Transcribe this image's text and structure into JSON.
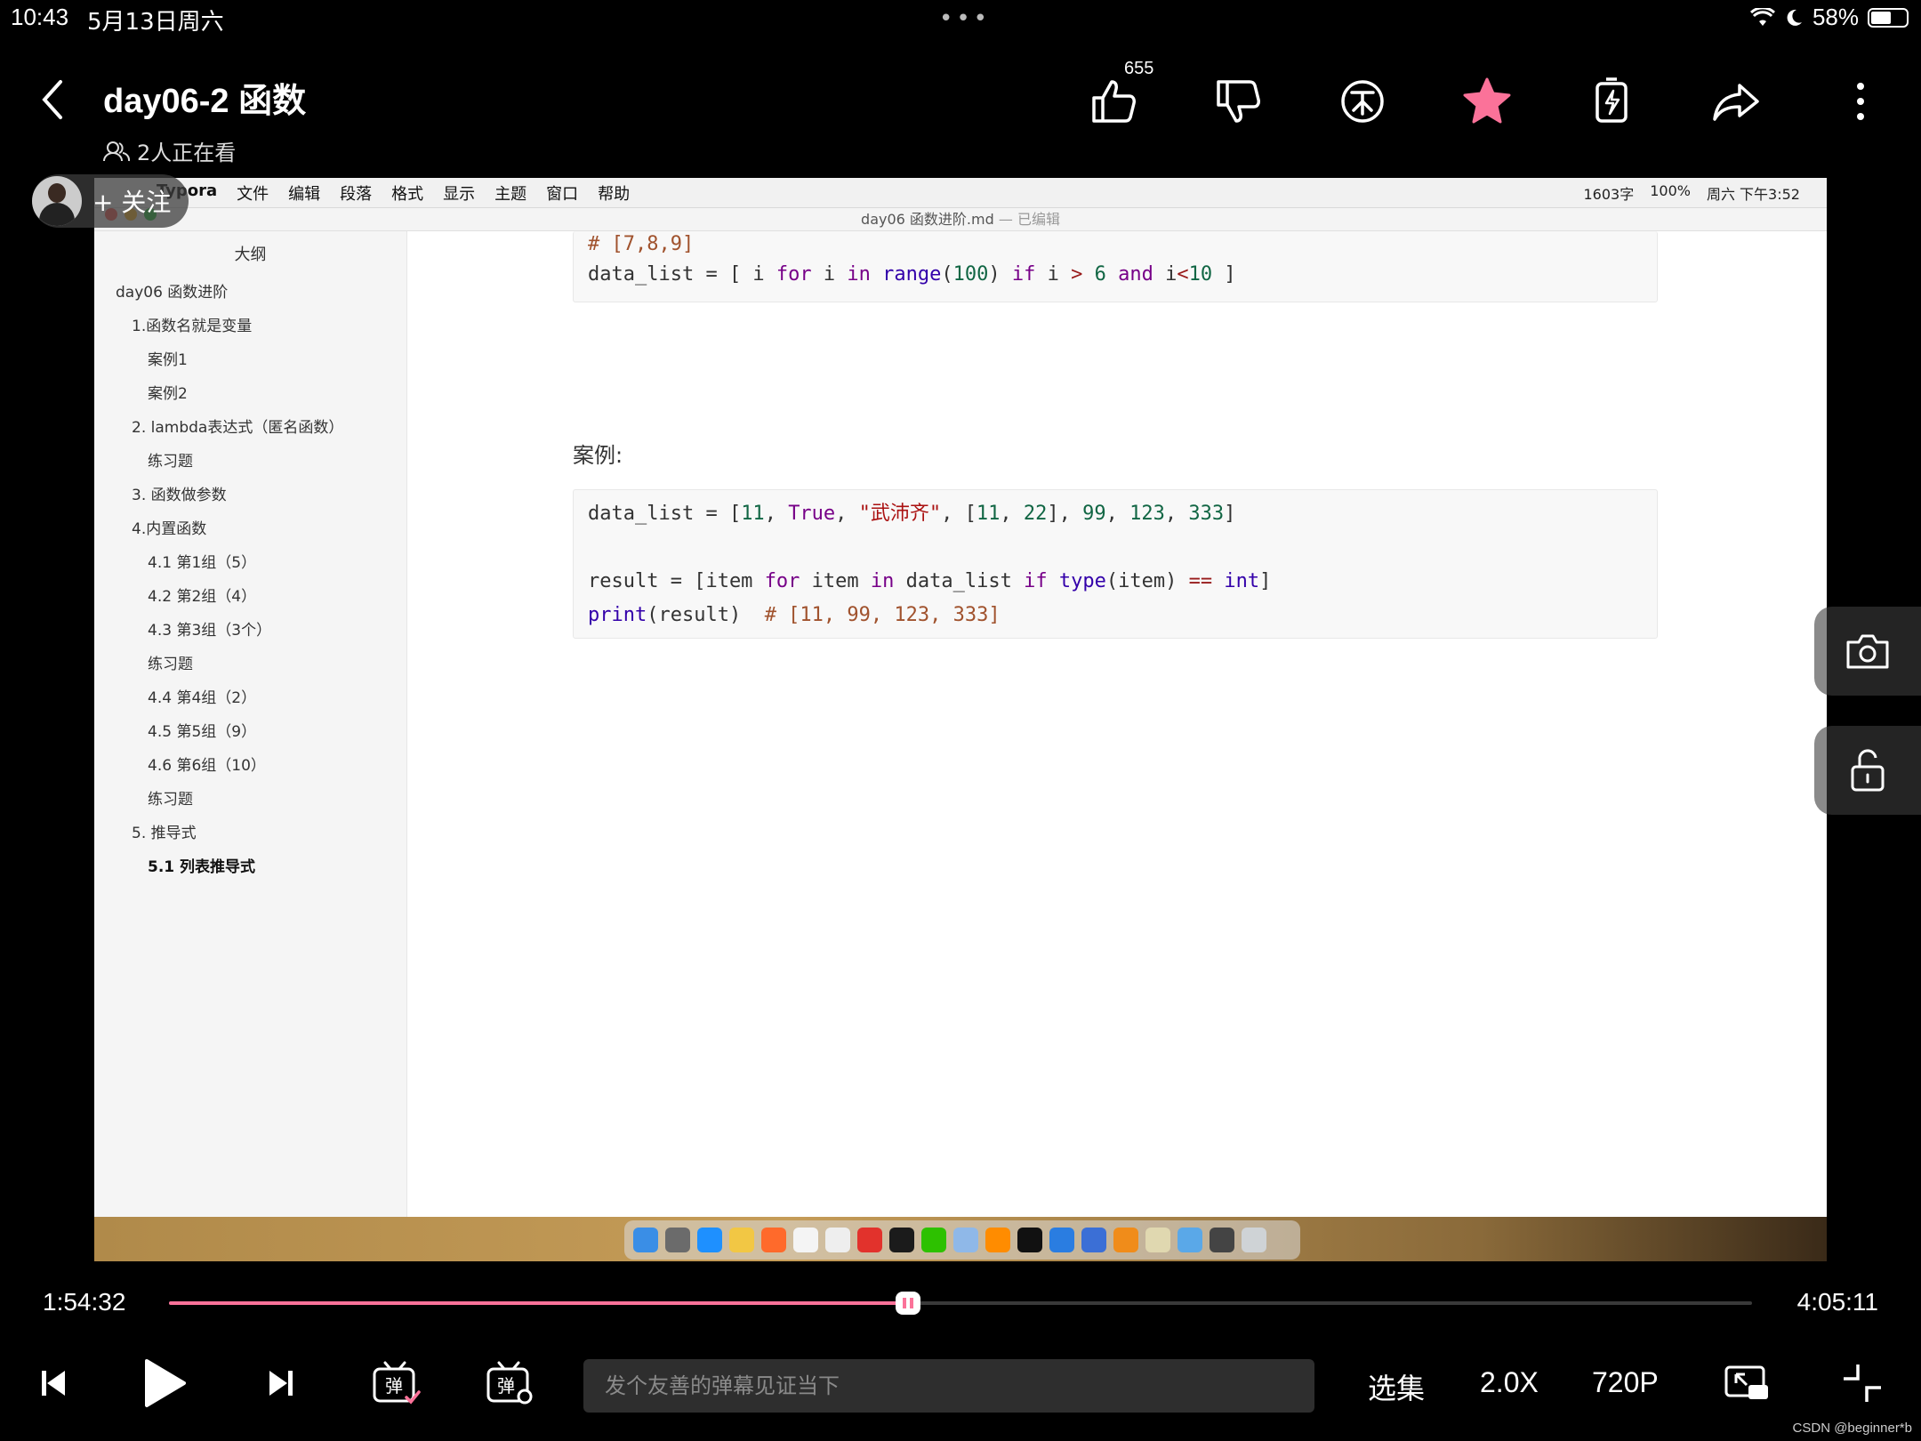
{
  "status_bar": {
    "time": "10:43",
    "date": "5月13日周六",
    "battery": "58%",
    "battery_level": 0.58
  },
  "header": {
    "title": "day06-2 函数",
    "viewers": "2人正在看",
    "like_count": "655"
  },
  "follow": {
    "label": "+ 关注"
  },
  "screen": {
    "menubar": {
      "app": "Typora",
      "items": [
        "文件",
        "编辑",
        "段落",
        "格式",
        "显示",
        "主题",
        "窗口",
        "帮助"
      ],
      "word_count": "1603字",
      "battery": "100%",
      "clock": "周六 下午3:52"
    },
    "doc_title": "day06 函数进阶.md",
    "doc_status": "— 已编辑",
    "outline": {
      "title": "大纲",
      "items": [
        {
          "label": "day06 函数进阶"
        },
        {
          "label": "1.函数名就是变量"
        },
        {
          "label": "案例1"
        },
        {
          "label": "案例2"
        },
        {
          "label": "2. lambda表达式（匿名函数）"
        },
        {
          "label": "练习题"
        },
        {
          "label": "3. 函数做参数"
        },
        {
          "label": "4.内置函数"
        },
        {
          "label": "4.1 第1组（5）"
        },
        {
          "label": "4.2 第2组（4）"
        },
        {
          "label": "4.3 第3组（3个）"
        },
        {
          "label": "练习题"
        },
        {
          "label": "4.4 第4组（2）"
        },
        {
          "label": "4.5 第5组（9）"
        },
        {
          "label": "4.6 第6组（10）"
        },
        {
          "label": "练习题"
        },
        {
          "label": "5. 推导式"
        },
        {
          "label": "5.1 列表推导式"
        }
      ]
    },
    "code1": {
      "comment": "# [7,8,9]",
      "line2": "data_list = [ i for i in range(100) if i > 6 and i<10 ]"
    },
    "case_label": "案例:",
    "code2": {
      "line1": "data_list = [11, True, \"武沛齐\", [11, 22], 99, 123, 333]",
      "line2": "",
      "line3": "result = [item for item in data_list if type(item) == int]",
      "line4": "print(result)  # [11, 99, 123, 333]"
    }
  },
  "player": {
    "current_time": "1:54:32",
    "total_time": "4:05:11",
    "progress": 0.4671,
    "danmaku_placeholder": "发个友善的弹幕见证当下",
    "episodes_label": "选集",
    "speed_label": "2.0X",
    "quality_label": "720P"
  },
  "watermark": "CSDN @beginner*b",
  "colors": {
    "accent": "#fb7299",
    "star": "#fb7299"
  }
}
